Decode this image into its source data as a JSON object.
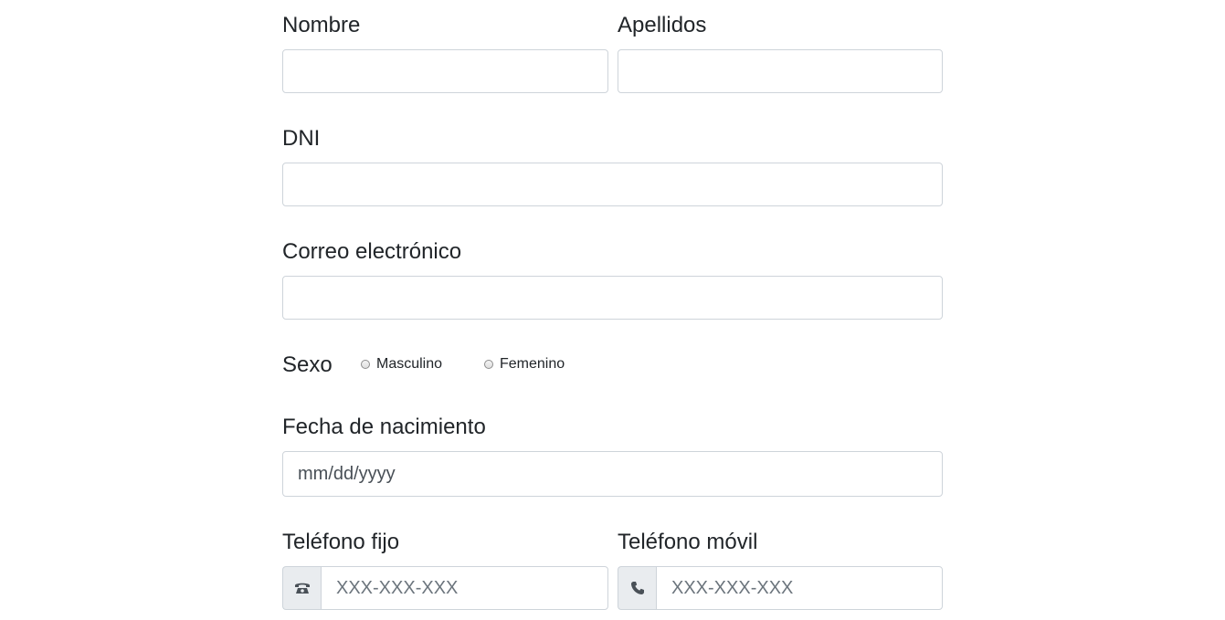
{
  "form": {
    "first_name": {
      "label": "Nombre",
      "value": "",
      "placeholder": ""
    },
    "last_name": {
      "label": "Apellidos",
      "value": "",
      "placeholder": ""
    },
    "dni": {
      "label": "DNI",
      "value": "",
      "placeholder": ""
    },
    "email": {
      "label": "Correo electrónico",
      "value": "",
      "placeholder": ""
    },
    "sex": {
      "label": "Sexo",
      "options": [
        {
          "label": "Masculino",
          "selected": false
        },
        {
          "label": "Femenino",
          "selected": false
        }
      ]
    },
    "birth_date": {
      "label": "Fecha de nacimiento",
      "display": "mm/dd/yyyy"
    },
    "landline": {
      "label": "Teléfono fijo",
      "placeholder": "XXX-XXX-XXX",
      "icon": "landline-phone-icon"
    },
    "mobile": {
      "label": "Teléfono móvil",
      "placeholder": "XXX-XXX-XXX",
      "icon": "phone-icon"
    }
  },
  "colors": {
    "border": "#ced4da",
    "addon_bg": "#e9ecef",
    "text": "#212529",
    "placeholder": "#6c757d"
  }
}
